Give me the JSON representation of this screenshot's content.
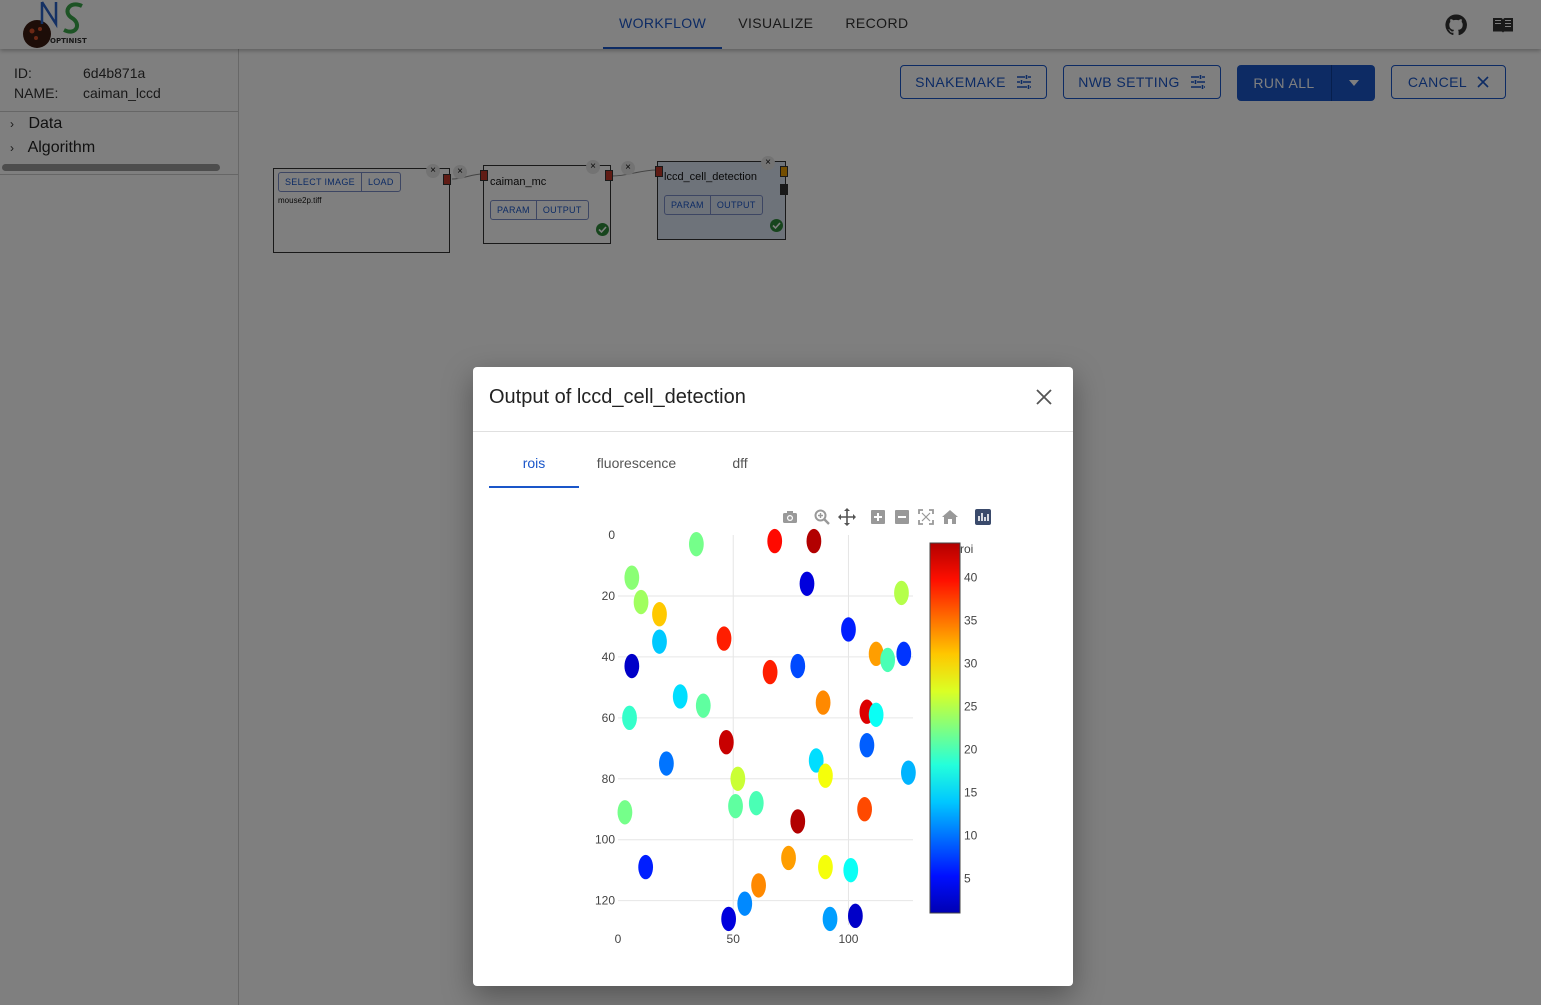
{
  "app": {
    "nav": [
      {
        "label": "WORKFLOW",
        "active": true
      },
      {
        "label": "VISUALIZE",
        "active": false
      },
      {
        "label": "RECORD",
        "active": false
      }
    ],
    "logo_text": "OPTINIST"
  },
  "sidebar": {
    "id_label": "ID:",
    "id_value": "6d4b871a",
    "name_label": "NAME:",
    "name_value": "caiman_lccd",
    "tree": [
      "Data",
      "Algorithm"
    ]
  },
  "toolbar": {
    "snakemake": "SNAKEMAKE",
    "nwb": "NWB SETTING",
    "run_all": "RUN ALL",
    "cancel": "CANCEL"
  },
  "nodes": {
    "image": {
      "select": "SELECT IMAGE",
      "load": "LOAD",
      "file": "mouse2p.tiff"
    },
    "mc": {
      "name": "caiman_mc",
      "param": "PARAM",
      "output": "OUTPUT"
    },
    "lccd": {
      "name": "lccd_cell_detection",
      "param": "PARAM",
      "output": "OUTPUT"
    }
  },
  "dialog": {
    "title": "Output of lccd_cell_detection",
    "tabs": [
      {
        "label": "rois",
        "active": true
      },
      {
        "label": "fluorescence",
        "active": false
      },
      {
        "label": "dff",
        "active": false
      }
    ],
    "modebar_icons": [
      "camera-icon",
      "zoom-icon",
      "pan-icon",
      "zoom-in-icon",
      "zoom-out-icon",
      "autoscale-icon",
      "reset-axes-icon",
      "plotly-logo-icon"
    ]
  },
  "chart_data": {
    "type": "heatmap",
    "title": "",
    "colorbar_title": "roi",
    "colorscale": "jet",
    "zlim": [
      1,
      44
    ],
    "colorbar_ticks": [
      5,
      10,
      15,
      20,
      25,
      30,
      35,
      40
    ],
    "x_ticks": [
      0,
      50,
      100
    ],
    "y_ticks": [
      0,
      20,
      40,
      60,
      80,
      100,
      120
    ],
    "xlim": [
      0,
      128
    ],
    "ylim": [
      128,
      0
    ],
    "grid": true,
    "rois": [
      {
        "x": 34,
        "y": 3,
        "roi": 22
      },
      {
        "x": 68,
        "y": 2,
        "roi": 40
      },
      {
        "x": 85,
        "y": 2,
        "roi": 44
      },
      {
        "x": 6,
        "y": 14,
        "roi": 23
      },
      {
        "x": 82,
        "y": 16,
        "roi": 3
      },
      {
        "x": 123,
        "y": 19,
        "roi": 25
      },
      {
        "x": 10,
        "y": 22,
        "roi": 24
      },
      {
        "x": 18,
        "y": 26,
        "roi": 31
      },
      {
        "x": 18,
        "y": 35,
        "roi": 14
      },
      {
        "x": 46,
        "y": 34,
        "roi": 39
      },
      {
        "x": 100,
        "y": 31,
        "roi": 6
      },
      {
        "x": 6,
        "y": 43,
        "roi": 2
      },
      {
        "x": 78,
        "y": 43,
        "roi": 8
      },
      {
        "x": 66,
        "y": 45,
        "roi": 39
      },
      {
        "x": 112,
        "y": 39,
        "roi": 33
      },
      {
        "x": 117,
        "y": 41,
        "roi": 20
      },
      {
        "x": 124,
        "y": 39,
        "roi": 7
      },
      {
        "x": 27,
        "y": 53,
        "roi": 15
      },
      {
        "x": 37,
        "y": 56,
        "roi": 21
      },
      {
        "x": 89,
        "y": 55,
        "roi": 34
      },
      {
        "x": 5,
        "y": 60,
        "roi": 19
      },
      {
        "x": 108,
        "y": 58,
        "roi": 42
      },
      {
        "x": 112,
        "y": 59,
        "roi": 17
      },
      {
        "x": 47,
        "y": 68,
        "roi": 43
      },
      {
        "x": 108,
        "y": 69,
        "roi": 9
      },
      {
        "x": 21,
        "y": 75,
        "roi": 10
      },
      {
        "x": 86,
        "y": 74,
        "roi": 15
      },
      {
        "x": 90,
        "y": 79,
        "roi": 28
      },
      {
        "x": 126,
        "y": 78,
        "roi": 13
      },
      {
        "x": 52,
        "y": 80,
        "roi": 26
      },
      {
        "x": 51,
        "y": 89,
        "roi": 21
      },
      {
        "x": 60,
        "y": 88,
        "roi": 20
      },
      {
        "x": 3,
        "y": 91,
        "roi": 22
      },
      {
        "x": 107,
        "y": 90,
        "roi": 37
      },
      {
        "x": 78,
        "y": 94,
        "roi": 44
      },
      {
        "x": 12,
        "y": 109,
        "roi": 6
      },
      {
        "x": 74,
        "y": 106,
        "roi": 33
      },
      {
        "x": 90,
        "y": 109,
        "roi": 28
      },
      {
        "x": 101,
        "y": 110,
        "roi": 17
      },
      {
        "x": 61,
        "y": 115,
        "roi": 34
      },
      {
        "x": 55,
        "y": 121,
        "roi": 11
      },
      {
        "x": 48,
        "y": 126,
        "roi": 3
      },
      {
        "x": 92,
        "y": 126,
        "roi": 12
      },
      {
        "x": 103,
        "y": 125,
        "roi": 2
      }
    ]
  }
}
